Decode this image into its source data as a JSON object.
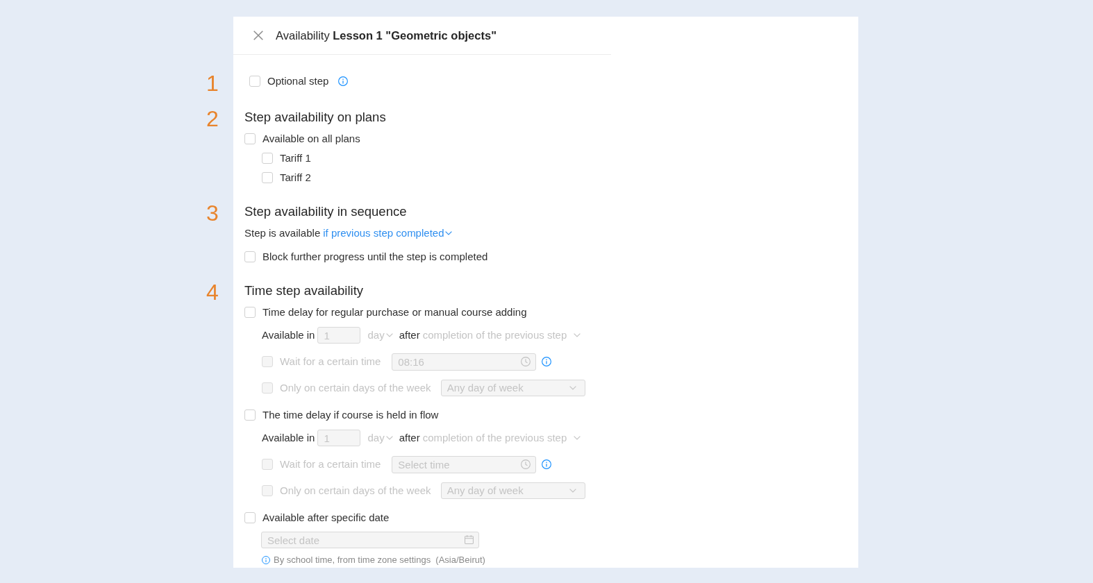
{
  "dialog": {
    "title": "Availability **Lesson 1 \"Geometric objects\"**"
  },
  "sections": [
    {
      "number": "1",
      "rows": [
        {
          "kind": "checkbox",
          "label": "Optional step",
          "checked": false,
          "info": true
        }
      ]
    },
    {
      "number": "2",
      "heading": "Step availability on plans",
      "rows": [
        {
          "kind": "checkbox",
          "label": "Available on all plans",
          "checked": false,
          "children": [
            {
              "kind": "checkbox",
              "label": "Tariff 1",
              "checked": false
            },
            {
              "kind": "checkbox",
              "label": "Tariff 2",
              "checked": false
            }
          ]
        }
      ]
    },
    {
      "number": "3",
      "heading": "Step availability in sequence",
      "rows": [
        {
          "kind": "condition",
          "label": "Step is available",
          "value": "if previous step completed"
        },
        {
          "kind": "checkbox",
          "label": "Block further progress until the step is completed",
          "checked": false
        }
      ]
    },
    {
      "number": "4",
      "heading": "Time step availability",
      "rows": [
        {
          "kind": "checkbox",
          "label": "Time delay for regular purchase or manual course adding",
          "checked": false,
          "children": [
            {
              "kind": "delay",
              "label": "Available in",
              "amount": "1",
              "unit": "day",
              "connector": "after",
              "reference": "completion of the previous step",
              "disabled": true
            },
            {
              "kind": "time",
              "label": "Wait for a certain time",
              "checked": false,
              "disabled": true,
              "value": "08:16",
              "info": true
            },
            {
              "kind": "weekdays",
              "label": "Only on certain days of the week",
              "checked": false,
              "disabled": true,
              "value": "Any day of week"
            }
          ]
        },
        {
          "kind": "checkbox",
          "label": "The time delay if course is held in flow",
          "checked": false,
          "children": [
            {
              "kind": "delay",
              "label": "Available in",
              "amount": "1",
              "unit": "day",
              "connector": "after",
              "reference": "completion of the previous step",
              "disabled": true
            },
            {
              "kind": "time",
              "label": "Wait for a certain time",
              "checked": false,
              "disabled": true,
              "placeholder": "Select time",
              "info": true
            },
            {
              "kind": "weekdays",
              "label": "Only on certain days of the week",
              "checked": false,
              "disabled": true,
              "value": "Any day of week"
            }
          ]
        },
        {
          "kind": "checkbox",
          "label": "Available after specific date",
          "checked": false,
          "children": [
            {
              "kind": "date",
              "placeholder": "Select date",
              "disabled": true
            },
            {
              "kind": "note",
              "text": "By school time, from time zone settings  (Asia/Beirut)"
            }
          ]
        }
      ]
    }
  ]
}
